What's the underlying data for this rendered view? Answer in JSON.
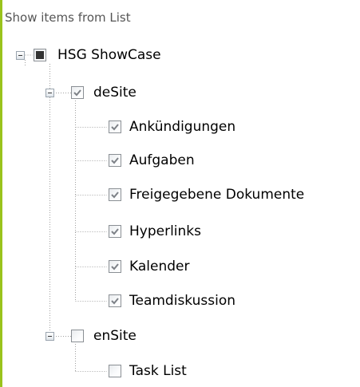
{
  "panel": {
    "title": "Show items from List"
  },
  "colors": {
    "accent_bar": "#9ac31c",
    "tree_line": "#a0a0a0",
    "check_mark": "#7d8187",
    "partial_fill": "#333333"
  },
  "tree": {
    "root": {
      "label": "HSG ShowCase",
      "state": "partial",
      "expanded": true
    },
    "desite": {
      "label": "deSite",
      "state": "checked",
      "expanded": true,
      "items": [
        {
          "label": "Ankündigungen",
          "state": "checked"
        },
        {
          "label": "Aufgaben",
          "state": "checked"
        },
        {
          "label": "Freigegebene Dokumente",
          "state": "checked"
        },
        {
          "label": "Hyperlinks",
          "state": "checked"
        },
        {
          "label": "Kalender",
          "state": "checked"
        },
        {
          "label": "Teamdiskussion",
          "state": "checked"
        }
      ]
    },
    "ensite": {
      "label": "enSite",
      "state": "unchecked",
      "expanded": true,
      "items": [
        {
          "label": "Task List",
          "state": "unchecked"
        }
      ]
    }
  }
}
